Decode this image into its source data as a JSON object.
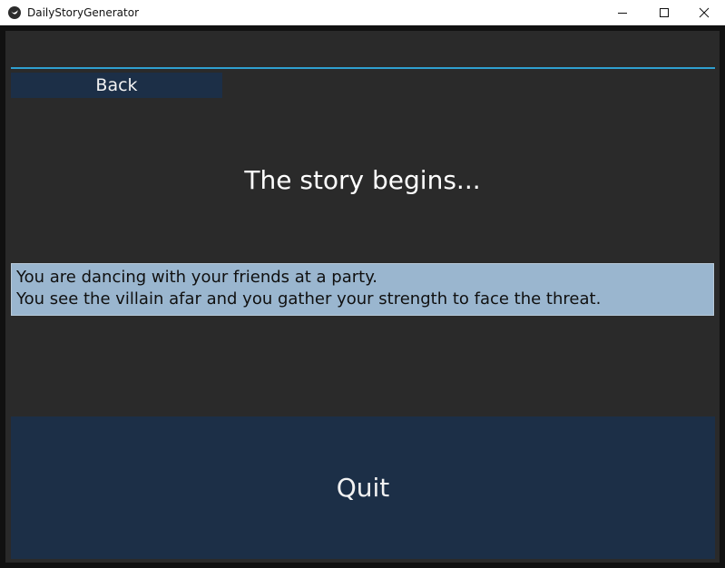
{
  "window": {
    "title": "DailyStoryGenerator",
    "icon": "app-logo-icon",
    "controls": {
      "minimize_icon": "minimize-icon",
      "maximize_icon": "maximize-icon",
      "close_icon": "close-icon"
    }
  },
  "screen": {
    "back_label": "Back",
    "heading": "The story begins...",
    "story_lines": [
      "You are dancing with your friends at a party.",
      "You see the villain afar and you gather your strength to face the threat."
    ],
    "quit_label": "Quit"
  },
  "colors": {
    "background": "#2a2a2a",
    "button": "#1c2f47",
    "accent_line": "#2f9fd0",
    "story_box": "#9ab6cf"
  }
}
